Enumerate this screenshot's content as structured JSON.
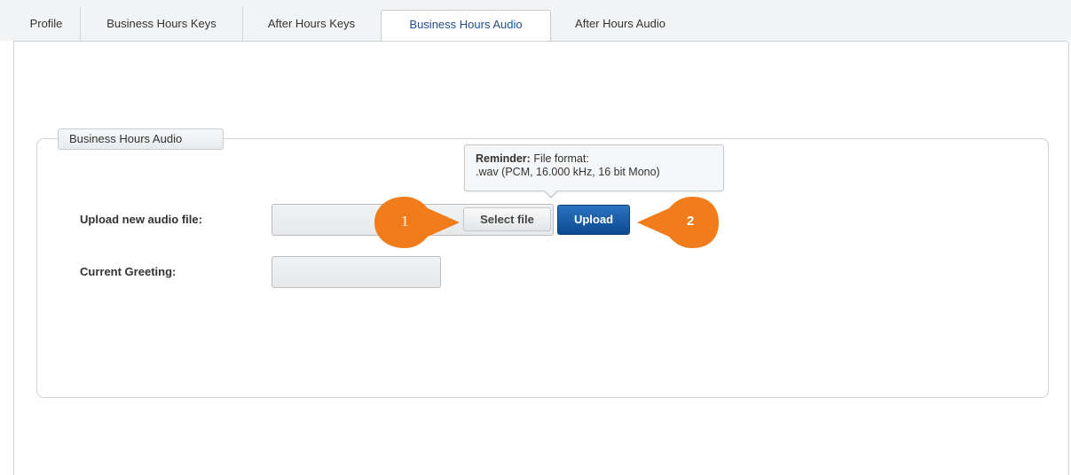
{
  "tabs": [
    {
      "label": "Profile",
      "active": false
    },
    {
      "label": "Business Hours Keys",
      "active": false
    },
    {
      "label": "After Hours Keys",
      "active": false
    },
    {
      "label": "Business Hours Audio",
      "active": true
    },
    {
      "label": "After Hours Audio",
      "active": false
    }
  ],
  "section": {
    "legend": "Business Hours Audio"
  },
  "upload": {
    "label": "Upload new audio file:",
    "select_button": "Select file",
    "upload_button": "Upload",
    "file_value": ""
  },
  "greeting": {
    "label": "Current Greeting:",
    "value": ""
  },
  "tooltip": {
    "title": "Reminder:",
    "line1": "File format:",
    "line2": ".wav (PCM, 16.000 kHz, 16 bit Mono)"
  },
  "callouts": [
    {
      "number": "1"
    },
    {
      "number": "2"
    }
  ],
  "colors": {
    "accent": "#1e4e8c",
    "upload_button": "#0c4a92",
    "callout": "#f07c1c"
  }
}
